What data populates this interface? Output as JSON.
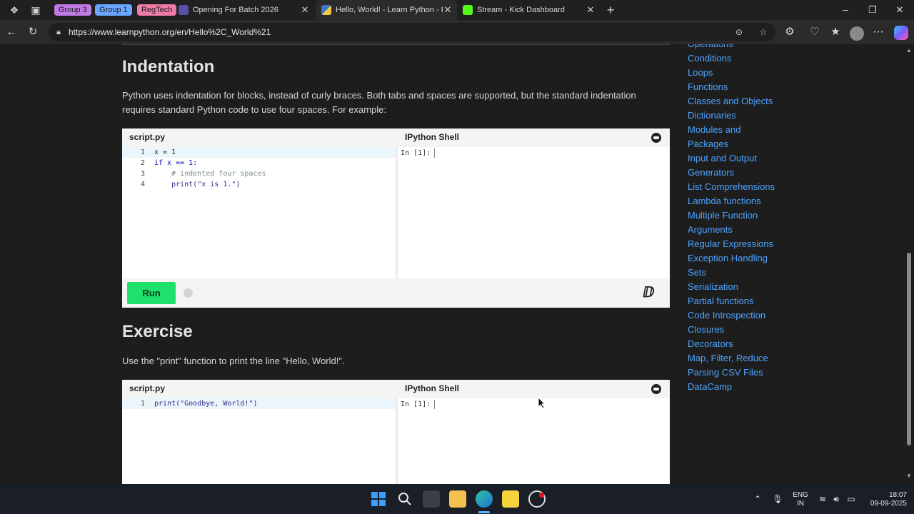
{
  "browser": {
    "tab_groups": [
      {
        "label": "Group 3",
        "color": "#c27be6"
      },
      {
        "label": "Group 1",
        "color": "#6aa6ff"
      },
      {
        "label": "RegTech",
        "color": "#f07ba8"
      }
    ],
    "tabs": [
      {
        "title": "Opening For Batch 2026",
        "active": false
      },
      {
        "title": "Hello, World! - Learn Python - Fre",
        "active": true
      },
      {
        "title": "Stream - Kick Dashboard",
        "active": false
      }
    ],
    "new_tab_symbol": "+",
    "url": "https://www.learnpython.org/en/Hello%2C_World%21"
  },
  "content": {
    "indentation": {
      "heading": "Indentation",
      "paragraph_line1": "Python uses indentation for blocks, instead of curly braces. Both tabs and spaces are supported, but the standard indentation",
      "paragraph_line2": "requires standard Python code to use four spaces. For example:",
      "editor_label": "script.py",
      "shell_label": "IPython Shell",
      "shell_prompt": "In [1]:",
      "run_label": "Run",
      "lines": [
        {
          "n": "1",
          "text": "x = 1"
        },
        {
          "n": "2",
          "text": "if x == 1:"
        },
        {
          "n": "3",
          "text": "    # indented four spaces"
        },
        {
          "n": "4",
          "text": "    print(\"x is 1.\")"
        }
      ]
    },
    "exercise": {
      "heading": "Exercise",
      "paragraph": "Use the \"print\" function to print the line \"Hello, World!\".",
      "editor_label": "script.py",
      "shell_label": "IPython Shell",
      "shell_prompt": "In [1]:",
      "lines": [
        {
          "n": "1",
          "text": "print(\"Goodbye, World!\")"
        }
      ]
    }
  },
  "sidebar": {
    "links": [
      "Operations",
      "Conditions",
      "Loops",
      "Functions",
      "Classes and Objects",
      "Dictionaries",
      "Modules and",
      "Packages",
      "Input and Output",
      "Generators",
      "List Comprehensions",
      "Lambda functions",
      "Multiple Function",
      "Arguments",
      "Regular Expressions",
      "Exception Handling",
      "Sets",
      "Serialization",
      "Partial functions",
      "Code Introspection",
      "Closures",
      "Decorators",
      "Map, Filter, Reduce",
      "Parsing CSV Files",
      "DataCamp"
    ],
    "link_color": "#4da3ff"
  },
  "taskbar": {
    "language": "ENG",
    "region": "IN",
    "time": "18:07",
    "date": "09-09-2025"
  },
  "icons": {
    "tab_actions": "tab-actions-icon",
    "workspaces": "workspaces-icon",
    "back": "back-arrow-icon",
    "refresh": "refresh-icon",
    "lock": "lock-icon"
  }
}
